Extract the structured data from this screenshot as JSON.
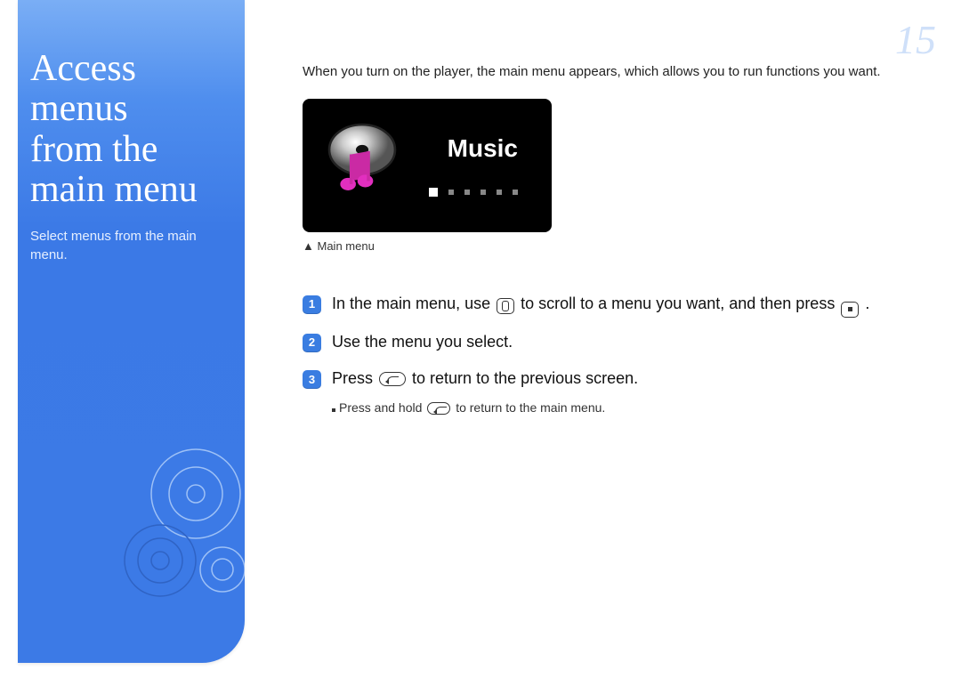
{
  "page_number": "15",
  "sidebar": {
    "title_line1": "Access menus",
    "title_line2": "from the",
    "title_line3": "main menu",
    "subtitle": "Select menus from the main menu."
  },
  "intro": "When you turn on the player, the main menu appears, which allows you to run functions you want.",
  "device_label": "Music",
  "caption_prefix": "▲",
  "caption_text": "Main menu",
  "steps": {
    "s1num": "1",
    "s1_a": "In the main menu, use ",
    "s1_b": " to scroll to a menu you want, and then press ",
    "s1_c": ".",
    "s2num": "2",
    "s2": "Use the menu you select.",
    "s3num": "3",
    "s3_a": "Press ",
    "s3_b": " to return to the previous screen."
  },
  "subnote_a": "Press and hold ",
  "subnote_b": " to return to the main menu."
}
